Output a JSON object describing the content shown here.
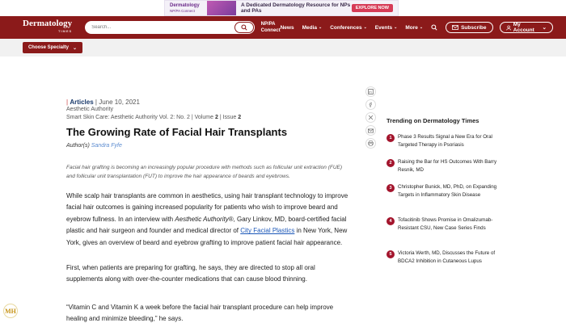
{
  "ad": {
    "logo_line1": "Dermatology",
    "logo_line2": "NP/PA Connect",
    "text": "A Dedicated Dermatology Resource for NPs and PAs",
    "cta": "EXPLORE NOW"
  },
  "header": {
    "brand": "Dermatology",
    "brand_sub": "TIMES",
    "search_placeholder": "Search...",
    "np_line1": "NP/PA",
    "np_line2": "Connect",
    "nav": [
      "News",
      "Media",
      "Conferences",
      "Events",
      "More"
    ],
    "subscribe": "Subscribe",
    "account": "My Account"
  },
  "specialty": {
    "label": "Choose Specialty"
  },
  "article": {
    "type": "Articles",
    "date": "June 10, 2021",
    "publication": "Aesthetic Authority",
    "journal": "Smart Skin Care: Aesthetic Authority Vol. 2: No. 2",
    "volume_label": "Volume",
    "volume": "2",
    "issue_label": "Issue",
    "issue": "2",
    "title": "The Growing Rate of Facial Hair Transplants",
    "authors_label": "Author(s)",
    "author": "Sandra Fyfe",
    "summary": "Facial hair grafting is becoming an increasingly popular procedure with methods such as follicular unit extraction (FUE) and follicular unit transplantation (FUT) to improve the hair appearance of beards and eyebrows.",
    "p1_a": "While scalp hair transplants are common in aesthetics, using hair transplant technology to improve facial hair outcomes is gaining increased popularity for patients who wish to improve beard and eyebrow fullness. In an interview with ",
    "p1_em": "Aesthetic Authority",
    "p1_b": "®, Gary Linkov, MD, board-certified facial plastic and hair surgeon and founder and medical director of ",
    "p1_link": "City Facial Plastics",
    "p1_c": " in New York, New York, gives an overview of beard and eyebrow grafting to improve patient facial hair appearance.",
    "p2": "First, when patients are preparing for grafting, he says, they are directed to stop all oral supplements along with over-the-counter medications that can cause blood thinning.",
    "p3": "“Vitamin C and Vitamin K a week before the facial hair transplant procedure can help improve healing and minimize bleeding,” he says."
  },
  "share_icons": [
    "linkedin-icon",
    "facebook-icon",
    "x-icon",
    "email-icon",
    "print-icon"
  ],
  "trending": {
    "title": "Trending on Dermatology Times",
    "items": [
      {
        "num": "1",
        "text": "Phase 3 Results Signal a New Era for Oral Targeted Therapy in Psoriasis"
      },
      {
        "num": "2",
        "text": "Raising the Bar for HS Outcomes With Barry Resnik, MD"
      },
      {
        "num": "3",
        "text": "Christopher Bunick, MD, PhD, on Expanding Targets in Inflammatory Skin Disease"
      },
      {
        "num": "4",
        "text": "Tofacitinib Shows Promise in Omalizumab-Resistant CSU, New Case Series Finds"
      },
      {
        "num": "5",
        "text": "Victoria Werth, MD, Discusses the Future of BDCA2 Inhibition in Cutaneous Lupus"
      }
    ]
  },
  "badge": "MH",
  "colors": {
    "brand": "#8b1a1a",
    "trend_num": "#a3142c",
    "link": "#1b57b8"
  }
}
